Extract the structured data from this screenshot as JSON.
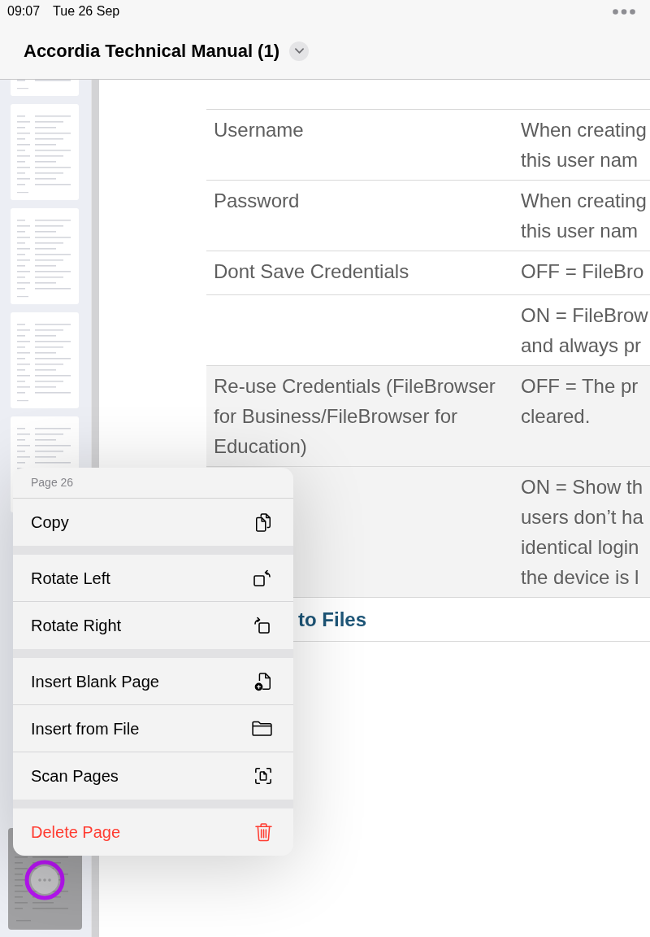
{
  "status_bar": {
    "time": "09:07",
    "date": "Tue 26 Sep"
  },
  "title_bar": {
    "title": "Accordia Technical Manual (1)"
  },
  "sidebar": {
    "thumbnails": [
      {
        "selected": false
      },
      {
        "selected": false
      },
      {
        "selected": false
      },
      {
        "selected": false
      },
      {
        "selected": false
      },
      {
        "selected": true
      }
    ]
  },
  "document": {
    "table": {
      "rows": [
        {
          "label": "Username",
          "description": [
            "When creating",
            "this user nam"
          ],
          "shaded": false
        },
        {
          "label": "Password",
          "description": [
            "When creating",
            "this user nam"
          ],
          "shaded": false
        },
        {
          "label": "Dont Save Credentials",
          "description": [
            "OFF = FileBro"
          ],
          "shaded": false
        },
        {
          "description": [
            "ON = FileBrow",
            "and always pr"
          ],
          "shaded": false
        },
        {
          "label": "Re-use Credentials (FileBrowser for Business/FileBrowser for Education)",
          "description": [
            "OFF = The pr",
            "cleared."
          ],
          "shaded": true
        },
        {
          "description": [
            "ON = Show th",
            "users don’t ha",
            "identical login",
            "the device is l"
          ],
          "shaded": true
        }
      ]
    },
    "heading": "to Files"
  },
  "context_menu": {
    "header": "Page 26",
    "groups": [
      {
        "items": [
          {
            "label": "Copy",
            "destructive": false
          }
        ]
      },
      {
        "items": [
          {
            "label": "Rotate Left",
            "destructive": false
          },
          {
            "label": "Rotate Right",
            "destructive": false
          }
        ]
      },
      {
        "items": [
          {
            "label": "Insert Blank Page",
            "destructive": false
          },
          {
            "label": "Insert from File",
            "destructive": false
          },
          {
            "label": "Scan Pages",
            "destructive": false
          }
        ]
      },
      {
        "items": [
          {
            "label": "Delete Page",
            "destructive": true
          }
        ]
      }
    ]
  }
}
